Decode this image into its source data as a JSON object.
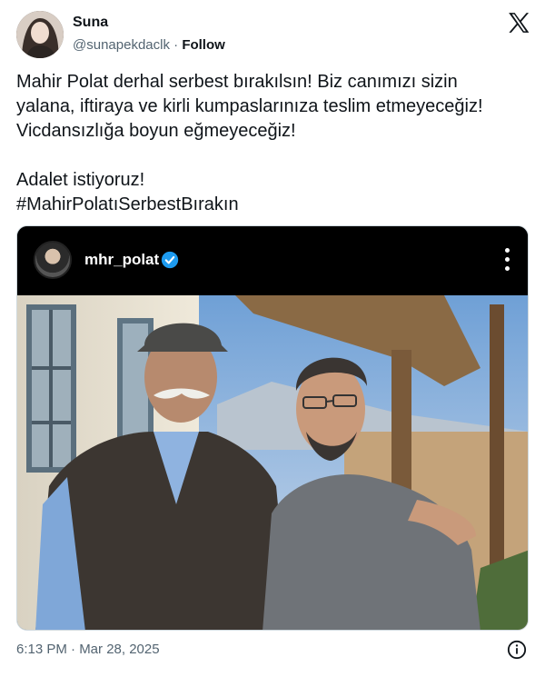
{
  "author": {
    "name": "Suna",
    "handle": "@sunapekdaclk",
    "separator": "·",
    "follow_label": "Follow"
  },
  "tweet": {
    "lines": [
      "Mahir Polat derhal serbest bırakılsın! Biz canımızı sizin",
      "yalana, iftiraya ve kirli kumpaslarınıza teslim etmeyeceğiz!",
      "Vicdansızlığa boyun eğmeyeceğiz!",
      "Adalet istiyoruz!",
      "#MahirPolatıSerbestBırakın"
    ]
  },
  "embed": {
    "username": "mhr_polat",
    "verified": true,
    "more_icon": "three-dots-vertical-icon"
  },
  "footer": {
    "timestamp": "6:13 PM · Mar 28, 2025",
    "info_icon": "info-icon"
  },
  "colors": {
    "text": "#0f1419",
    "muted": "#536471",
    "verified_blue": "#1d9bf0"
  }
}
